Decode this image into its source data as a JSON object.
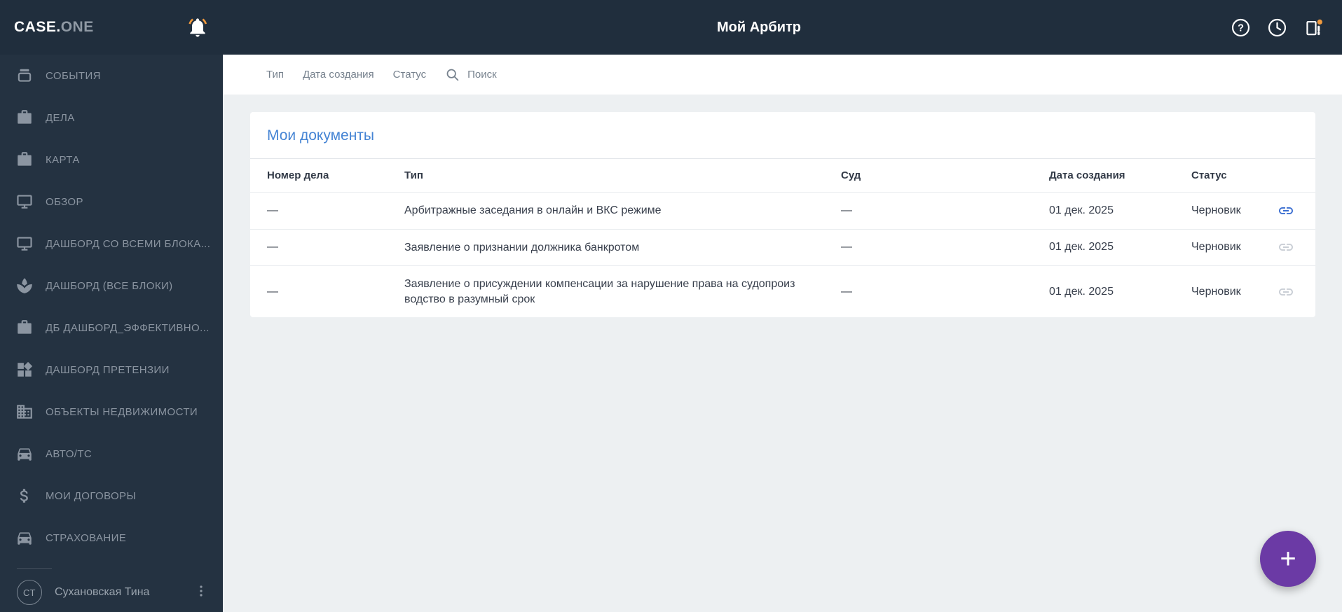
{
  "header": {
    "logo_primary": "CASE.",
    "logo_secondary": "ONE",
    "title": "Мой Арбитр",
    "icons": [
      "bell-icon",
      "help-icon",
      "history-clock-icon",
      "panel-notification-icon"
    ]
  },
  "sidebar": {
    "items": [
      {
        "label": "СОБЫТИЯ",
        "icon": "events-tray-icon"
      },
      {
        "label": "ДЕЛА",
        "icon": "briefcase-icon"
      },
      {
        "label": "КАРТА",
        "icon": "briefcase-icon"
      },
      {
        "label": "ОБЗОР",
        "icon": "monitor-icon"
      },
      {
        "label": "ДАШБОРД СО ВСЕМИ БЛОКА...",
        "icon": "monitor-icon"
      },
      {
        "label": "ДАШБОРД (ВСЕ БЛОКИ)",
        "icon": "spa-icon"
      },
      {
        "label": "ДБ ДАШБОРД_ЭФФЕКТИВНО...",
        "icon": "briefcase-icon"
      },
      {
        "label": "ДАШБОРД ПРЕТЕНЗИИ",
        "icon": "widgets-icon"
      },
      {
        "label": "ОБЪЕКТЫ НЕДВИЖИМОСТИ",
        "icon": "building-icon"
      },
      {
        "label": "АВТО/ТС",
        "icon": "car-icon"
      },
      {
        "label": "МОИ ДОГОВОРЫ",
        "icon": "dollar-icon"
      },
      {
        "label": "СТРАХОВАНИЕ",
        "icon": "car-icon"
      }
    ],
    "user": {
      "initials": "СТ",
      "name": "Сухановская Тина"
    }
  },
  "filters": {
    "items": [
      "Тип",
      "Дата создания",
      "Статус"
    ],
    "search_label": "Поиск"
  },
  "main": {
    "card_title": "Мои документы",
    "table": {
      "columns": [
        "Номер дела",
        "Тип",
        "Суд",
        "Дата создания",
        "Статус"
      ],
      "rows": [
        {
          "case_number": "—",
          "type": "Арбитражные заседания в онлайн и ВКС режиме",
          "court": "—",
          "created": "01 дек. 2025",
          "status": "Черновик",
          "link_active": true
        },
        {
          "case_number": "—",
          "type": "Заявление о признании должника банкротом",
          "court": "—",
          "created": "01 дек. 2025",
          "status": "Черновик",
          "link_active": false
        },
        {
          "case_number": "—",
          "type": "Заявление о присуждении компенсации за нарушение права на судопроиз\nводство в разумный срок",
          "court": "—",
          "created": "01 дек. 2025",
          "status": "Черновик",
          "link_active": false
        }
      ]
    }
  },
  "fab": {
    "label": "+"
  },
  "colors": {
    "header_bg": "#202E3D",
    "sidebar_bg": "#243241",
    "accent_blue": "#4584D4",
    "link_active": "#3C6FD1",
    "fab_purple": "#6B3AA5",
    "notification_orange": "#F09A3E",
    "content_bg": "#EDF0F2"
  }
}
